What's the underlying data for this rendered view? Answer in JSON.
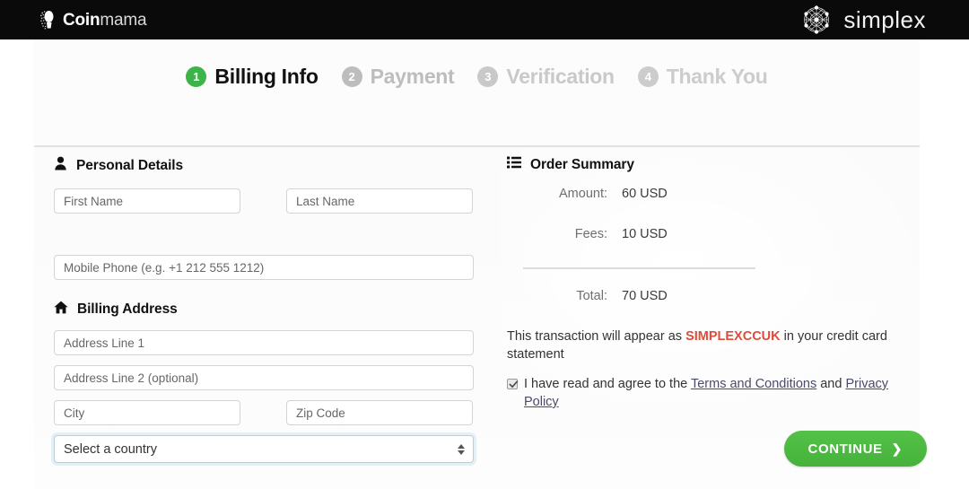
{
  "header": {
    "brand_bold": "Coin",
    "brand_light": "mama",
    "partner_name": "simplex",
    "brand_mark_icon": "coinmama-logo-icon",
    "partner_mark_icon": "simplex-network-icon"
  },
  "steps": [
    {
      "number": "1",
      "label": "Billing Info",
      "state": "active"
    },
    {
      "number": "2",
      "label": "Payment",
      "state": "inactive"
    },
    {
      "number": "3",
      "label": "Verification",
      "state": "inactive"
    },
    {
      "number": "4",
      "label": "Thank You",
      "state": "inactive"
    }
  ],
  "personal_details": {
    "title": "Personal Details",
    "icon": "person-icon",
    "first_name": {
      "placeholder": "First Name",
      "value": ""
    },
    "last_name": {
      "placeholder": "Last Name",
      "value": ""
    },
    "mobile_phone": {
      "placeholder": "Mobile Phone (e.g. +1 212 555 1212)",
      "value": ""
    }
  },
  "billing_address": {
    "title": "Billing Address",
    "icon": "home-icon",
    "address_line_1": {
      "placeholder": "Address Line 1",
      "value": ""
    },
    "address_line_2": {
      "placeholder": "Address Line 2 (optional)",
      "value": ""
    },
    "city": {
      "placeholder": "City",
      "value": ""
    },
    "zip_code": {
      "placeholder": "Zip Code",
      "value": ""
    },
    "country": {
      "selected": "Select a country"
    }
  },
  "order_summary": {
    "title": "Order Summary",
    "icon": "list-icon",
    "rows": [
      {
        "label": "Amount:",
        "value": "60 USD"
      },
      {
        "label": "Fees:",
        "value": "10 USD"
      }
    ],
    "total": {
      "label": "Total:",
      "value": "70 USD"
    }
  },
  "statement": {
    "prefix": "This transaction will appear as ",
    "code": "SIMPLEXCCUK",
    "suffix": " in your credit card statement"
  },
  "agreement": {
    "checked": true,
    "prefix": "I have read and agree to the ",
    "terms_link": "Terms and Conditions",
    "conjunction": " and ",
    "privacy_link": "Privacy Policy"
  },
  "actions": {
    "continue_label": "CONTINUE",
    "continue_chevron": "❯"
  },
  "colors": {
    "brand_green": "#4ab940",
    "step_active_green": "#3cb44a",
    "statement_code_red": "#e04b3a",
    "header_black": "#0a0a0a",
    "muted_gray": "#bdbdbd",
    "link_color": "#4a4a6a"
  }
}
